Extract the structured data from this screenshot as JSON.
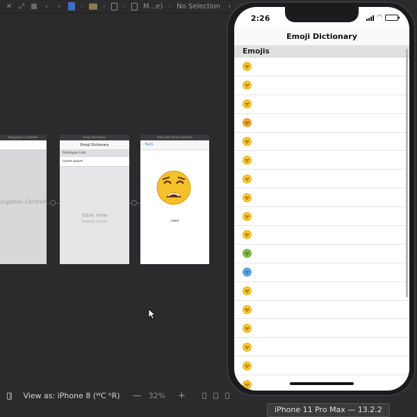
{
  "xcode": {
    "jumpbar": {
      "breadcrumb_truncated": "M...e)",
      "selection": "No Selection"
    },
    "storyboard": {
      "nav_scene_title": "Navigation Controller",
      "nav_scene_big_label": "Navigation Controller",
      "table_scene_title": "Emoji Dictionary",
      "table_scene_nav_title": "Emoji Dictionary",
      "prototype_cells_header": "Prototype Cells",
      "prototype_cell_label": "Lorem Ipsum",
      "table_view_label": "Table View",
      "table_view_sublabel": "Prototype Content",
      "detail_scene_title": "Emoji Def View Controller",
      "detail_back": "Back",
      "detail_label": "Label"
    },
    "bottom_toolbar": {
      "view_as": "View as: iPhone 8 (ᵂC ʰR)",
      "zoom_minus": "—",
      "zoom_level": "32%",
      "zoom_plus": "+"
    },
    "simulator_tooltip": "iPhone 11 Pro Max — 13.2.2"
  },
  "simulator": {
    "status_time": "2:26",
    "battery_level": 0.9,
    "nav_title": "Emoji Dictionary",
    "section_header": "Emojis",
    "rows": [
      {
        "name": "grinning-face-emoji",
        "color": "#f7c52a"
      },
      {
        "name": "grin-sweat-emoji",
        "color": "#f7c52a"
      },
      {
        "name": "tears-of-joy-emoji",
        "color": "#f7c52a"
      },
      {
        "name": "heart-eyes-emoji",
        "color": "#f2a530"
      },
      {
        "name": "kissing-face-emoji",
        "color": "#f7c52a"
      },
      {
        "name": "neutral-face-emoji",
        "color": "#f7c52a"
      },
      {
        "name": "sob-emoji",
        "color": "#f7c52a"
      },
      {
        "name": "thinking-face-emoji",
        "color": "#f7c52a"
      },
      {
        "name": "flushed-face-emoji",
        "color": "#f7c52a"
      },
      {
        "name": "shushing-face-emoji",
        "color": "#f7c52a"
      },
      {
        "name": "nauseated-face-emoji",
        "color": "#7cbf44"
      },
      {
        "name": "cold-face-emoji",
        "color": "#5aa8e6"
      },
      {
        "name": "hushed-face-emoji",
        "color": "#f7c52a"
      },
      {
        "name": "kissing-face-emoji",
        "color": "#f7c52a"
      },
      {
        "name": "expressionless-face-emoji",
        "color": "#f7c52a"
      },
      {
        "name": "sleepy-face-emoji",
        "color": "#f7c52a"
      },
      {
        "name": "rolling-eyes-emoji",
        "color": "#f7c52a"
      },
      {
        "name": "pleading-face-emoji",
        "color": "#f7c52a"
      }
    ]
  }
}
